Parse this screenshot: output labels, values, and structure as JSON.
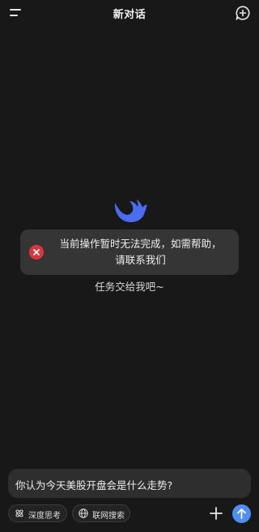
{
  "header": {
    "title": "新对话",
    "menu_icon": "menu-icon",
    "new_chat_icon": "new-chat-icon"
  },
  "toast": {
    "line1": "当前操作暂时无法完成，如需帮助，",
    "line2": "请联系我们",
    "icon": "error-icon",
    "icon_color": "#d9363e"
  },
  "main": {
    "logo_icon": "whale-logo-icon",
    "subtitle": "任务交给我吧~"
  },
  "composer": {
    "input_value": "你认为今天美股开盘会是什么走势?",
    "deep_think_label": "深度思考",
    "web_search_label": "联网搜索",
    "send_color": "#4d8ff5"
  }
}
